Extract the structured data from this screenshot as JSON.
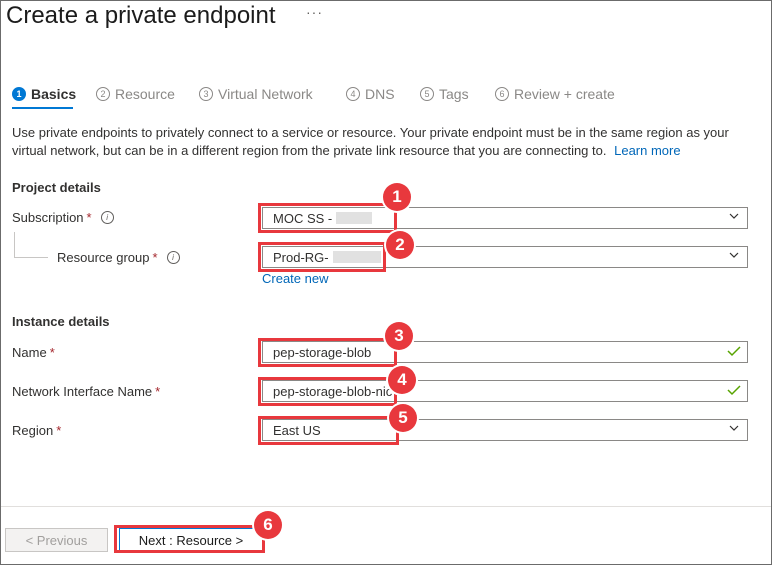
{
  "page": {
    "title": "Create a private endpoint",
    "more_label": "···"
  },
  "steps": [
    {
      "num": "1",
      "label": "Basics"
    },
    {
      "num": "2",
      "label": "Resource"
    },
    {
      "num": "3",
      "label": "Virtual Network"
    },
    {
      "num": "4",
      "label": "DNS"
    },
    {
      "num": "5",
      "label": "Tags"
    },
    {
      "num": "6",
      "label": "Review + create"
    }
  ],
  "description": {
    "text": "Use private endpoints to privately connect to a service or resource. Your private endpoint must be in the same region as your virtual network, but can be in a different region from the private link resource that you are connecting to.",
    "learn_more": "Learn more"
  },
  "project_details": {
    "heading": "Project details",
    "subscription_label": "Subscription",
    "subscription_value": "MOC SS -",
    "resource_group_label": "Resource group",
    "resource_group_value": "Prod-RG-",
    "create_new": "Create new"
  },
  "instance_details": {
    "heading": "Instance details",
    "name_label": "Name",
    "name_value": "pep-storage-blob",
    "nic_label": "Network Interface Name",
    "nic_value": "pep-storage-blob-nic",
    "region_label": "Region",
    "region_value": "East US"
  },
  "required_marker": "*",
  "info_glyph": "i",
  "callouts": [
    "1",
    "2",
    "3",
    "4",
    "5",
    "6"
  ],
  "footer": {
    "previous": "< Previous",
    "next": "Next : Resource >"
  },
  "colors": {
    "accent": "#0078d4",
    "highlight": "#e8383d",
    "valid": "#57a300",
    "required": "#a4262c"
  }
}
